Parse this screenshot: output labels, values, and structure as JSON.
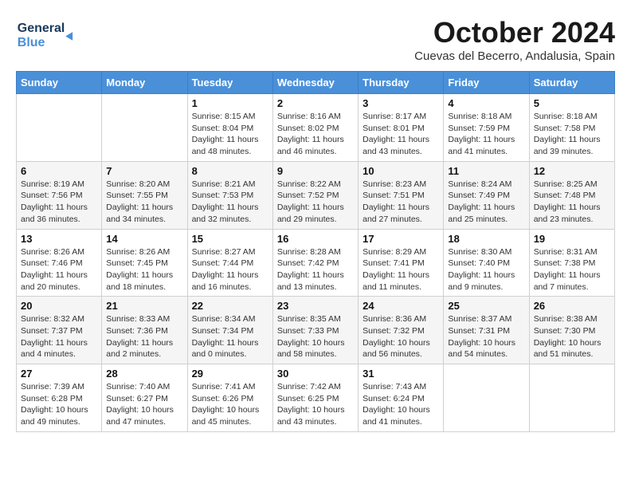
{
  "header": {
    "logo_line1": "General",
    "logo_line2": "Blue",
    "month": "October 2024",
    "location": "Cuevas del Becerro, Andalusia, Spain"
  },
  "weekdays": [
    "Sunday",
    "Monday",
    "Tuesday",
    "Wednesday",
    "Thursday",
    "Friday",
    "Saturday"
  ],
  "weeks": [
    [
      {
        "day": "",
        "info": ""
      },
      {
        "day": "",
        "info": ""
      },
      {
        "day": "1",
        "info": "Sunrise: 8:15 AM\nSunset: 8:04 PM\nDaylight: 11 hours and 48 minutes."
      },
      {
        "day": "2",
        "info": "Sunrise: 8:16 AM\nSunset: 8:02 PM\nDaylight: 11 hours and 46 minutes."
      },
      {
        "day": "3",
        "info": "Sunrise: 8:17 AM\nSunset: 8:01 PM\nDaylight: 11 hours and 43 minutes."
      },
      {
        "day": "4",
        "info": "Sunrise: 8:18 AM\nSunset: 7:59 PM\nDaylight: 11 hours and 41 minutes."
      },
      {
        "day": "5",
        "info": "Sunrise: 8:18 AM\nSunset: 7:58 PM\nDaylight: 11 hours and 39 minutes."
      }
    ],
    [
      {
        "day": "6",
        "info": "Sunrise: 8:19 AM\nSunset: 7:56 PM\nDaylight: 11 hours and 36 minutes."
      },
      {
        "day": "7",
        "info": "Sunrise: 8:20 AM\nSunset: 7:55 PM\nDaylight: 11 hours and 34 minutes."
      },
      {
        "day": "8",
        "info": "Sunrise: 8:21 AM\nSunset: 7:53 PM\nDaylight: 11 hours and 32 minutes."
      },
      {
        "day": "9",
        "info": "Sunrise: 8:22 AM\nSunset: 7:52 PM\nDaylight: 11 hours and 29 minutes."
      },
      {
        "day": "10",
        "info": "Sunrise: 8:23 AM\nSunset: 7:51 PM\nDaylight: 11 hours and 27 minutes."
      },
      {
        "day": "11",
        "info": "Sunrise: 8:24 AM\nSunset: 7:49 PM\nDaylight: 11 hours and 25 minutes."
      },
      {
        "day": "12",
        "info": "Sunrise: 8:25 AM\nSunset: 7:48 PM\nDaylight: 11 hours and 23 minutes."
      }
    ],
    [
      {
        "day": "13",
        "info": "Sunrise: 8:26 AM\nSunset: 7:46 PM\nDaylight: 11 hours and 20 minutes."
      },
      {
        "day": "14",
        "info": "Sunrise: 8:26 AM\nSunset: 7:45 PM\nDaylight: 11 hours and 18 minutes."
      },
      {
        "day": "15",
        "info": "Sunrise: 8:27 AM\nSunset: 7:44 PM\nDaylight: 11 hours and 16 minutes."
      },
      {
        "day": "16",
        "info": "Sunrise: 8:28 AM\nSunset: 7:42 PM\nDaylight: 11 hours and 13 minutes."
      },
      {
        "day": "17",
        "info": "Sunrise: 8:29 AM\nSunset: 7:41 PM\nDaylight: 11 hours and 11 minutes."
      },
      {
        "day": "18",
        "info": "Sunrise: 8:30 AM\nSunset: 7:40 PM\nDaylight: 11 hours and 9 minutes."
      },
      {
        "day": "19",
        "info": "Sunrise: 8:31 AM\nSunset: 7:38 PM\nDaylight: 11 hours and 7 minutes."
      }
    ],
    [
      {
        "day": "20",
        "info": "Sunrise: 8:32 AM\nSunset: 7:37 PM\nDaylight: 11 hours and 4 minutes."
      },
      {
        "day": "21",
        "info": "Sunrise: 8:33 AM\nSunset: 7:36 PM\nDaylight: 11 hours and 2 minutes."
      },
      {
        "day": "22",
        "info": "Sunrise: 8:34 AM\nSunset: 7:34 PM\nDaylight: 11 hours and 0 minutes."
      },
      {
        "day": "23",
        "info": "Sunrise: 8:35 AM\nSunset: 7:33 PM\nDaylight: 10 hours and 58 minutes."
      },
      {
        "day": "24",
        "info": "Sunrise: 8:36 AM\nSunset: 7:32 PM\nDaylight: 10 hours and 56 minutes."
      },
      {
        "day": "25",
        "info": "Sunrise: 8:37 AM\nSunset: 7:31 PM\nDaylight: 10 hours and 54 minutes."
      },
      {
        "day": "26",
        "info": "Sunrise: 8:38 AM\nSunset: 7:30 PM\nDaylight: 10 hours and 51 minutes."
      }
    ],
    [
      {
        "day": "27",
        "info": "Sunrise: 7:39 AM\nSunset: 6:28 PM\nDaylight: 10 hours and 49 minutes."
      },
      {
        "day": "28",
        "info": "Sunrise: 7:40 AM\nSunset: 6:27 PM\nDaylight: 10 hours and 47 minutes."
      },
      {
        "day": "29",
        "info": "Sunrise: 7:41 AM\nSunset: 6:26 PM\nDaylight: 10 hours and 45 minutes."
      },
      {
        "day": "30",
        "info": "Sunrise: 7:42 AM\nSunset: 6:25 PM\nDaylight: 10 hours and 43 minutes."
      },
      {
        "day": "31",
        "info": "Sunrise: 7:43 AM\nSunset: 6:24 PM\nDaylight: 10 hours and 41 minutes."
      },
      {
        "day": "",
        "info": ""
      },
      {
        "day": "",
        "info": ""
      }
    ]
  ]
}
